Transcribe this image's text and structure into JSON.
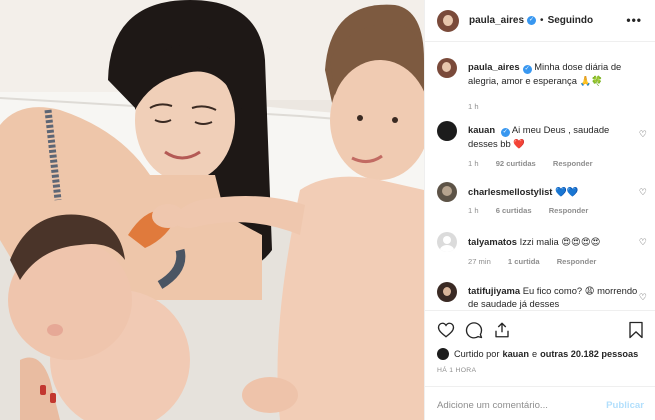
{
  "header": {
    "username": "paula_aires",
    "separator": "•",
    "follow_status": "Seguindo",
    "more": "•••"
  },
  "caption": {
    "username": "paula_aires",
    "text": "Minha dose diária de alegria, amor e esperança",
    "emojis": "🙏🍀",
    "time": "1 h"
  },
  "comments": [
    {
      "username": "kauan",
      "text": "Ai meu Deus , saudade desses bb",
      "emoji": "❤️",
      "time": "1 h",
      "likes": "92 curtidas",
      "reply": "Responder"
    },
    {
      "username": "charlesmellostylist",
      "text": "",
      "emoji": "💙💙",
      "time": "1 h",
      "likes": "6 curtidas",
      "reply": "Responder"
    },
    {
      "username": "talyamatos",
      "text": "Izzi malia",
      "emoji": "😍😍😍😍",
      "time": "27 min",
      "likes": "1 curtida",
      "reply": "Responder"
    },
    {
      "username": "tatifujiyama",
      "text": "Eu fico como?",
      "emoji": "😩",
      "text2": "morrendo de saudade já desses"
    }
  ],
  "likes": {
    "prefix": "Curtido por",
    "user": "kauan",
    "conj": "e",
    "others": "outras 20.182 pessoas"
  },
  "timestamp": "HÁ 1 HORA",
  "add_comment": {
    "placeholder": "Adicione um comentário...",
    "publish": "Publicar"
  },
  "colors": {
    "accent": "#3897f0",
    "publish_disabled": "#b2dffc",
    "heart_red": "#ed4956",
    "muted": "#8e8e8e",
    "border": "#efefef"
  },
  "icons": [
    "verified-badge-icon",
    "heart-icon",
    "comment-icon",
    "share-icon",
    "bookmark-icon"
  ]
}
